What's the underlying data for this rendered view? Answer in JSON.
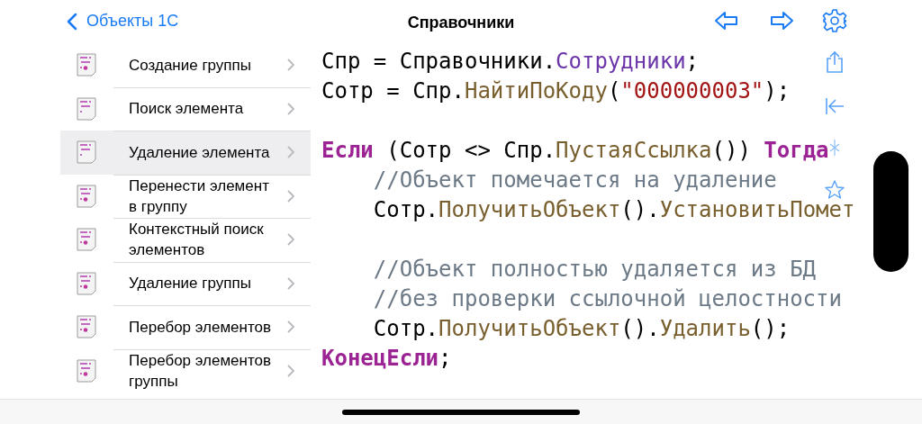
{
  "nav": {
    "back": "Объекты 1С",
    "title": "Справочники"
  },
  "list": [
    {
      "label": "Создание группы",
      "selected": false,
      "dot": true
    },
    {
      "label": "Поиск элемента",
      "selected": false,
      "dot": false
    },
    {
      "label": "Удаление элемента",
      "selected": true,
      "dot": false
    },
    {
      "label": "Перенести элемент в группу",
      "selected": false,
      "dot": true
    },
    {
      "label": "Контекстный поиск элементов",
      "selected": false,
      "dot": true
    },
    {
      "label": "Удаление группы",
      "selected": false,
      "dot": true
    },
    {
      "label": "Перебор элементов",
      "selected": false,
      "dot": true
    },
    {
      "label": "Перебор элементов группы",
      "selected": false,
      "dot": true
    }
  ],
  "code": [
    {
      "kind": "code",
      "tokens": [
        {
          "t": "Спр = Справочники.",
          "kind": "plain"
        },
        {
          "t": "Сотрудники",
          "kind": "type"
        },
        {
          "t": ";",
          "kind": "plain"
        }
      ]
    },
    {
      "kind": "code",
      "tokens": [
        {
          "t": "Сотр = Спр.",
          "kind": "plain"
        },
        {
          "t": "НайтиПоКоду",
          "kind": "method"
        },
        {
          "t": "(",
          "kind": "plain"
        },
        {
          "t": "\"000000003\"",
          "kind": "string"
        },
        {
          "t": ");",
          "kind": "plain"
        }
      ]
    },
    {
      "kind": "blank"
    },
    {
      "kind": "code",
      "tokens": [
        {
          "t": "Если",
          "kind": "keyword"
        },
        {
          "t": " (Сотр <> Спр.",
          "kind": "plain"
        },
        {
          "t": "ПустаяСсылка",
          "kind": "method"
        },
        {
          "t": "()) ",
          "kind": "plain"
        },
        {
          "t": "Тогда",
          "kind": "keyword"
        }
      ]
    },
    {
      "kind": "code",
      "tokens": [
        {
          "t": "    //Объект помечается на удаление",
          "kind": "comment"
        }
      ]
    },
    {
      "kind": "code",
      "tokens": [
        {
          "t": "    Сотр.",
          "kind": "plain"
        },
        {
          "t": "ПолучитьОбъект",
          "kind": "method"
        },
        {
          "t": "().",
          "kind": "plain"
        },
        {
          "t": "УстановитьПомет",
          "kind": "method"
        }
      ]
    },
    {
      "kind": "blank"
    },
    {
      "kind": "code",
      "tokens": [
        {
          "t": "    //Объект полностью удаляется из БД",
          "kind": "comment"
        }
      ]
    },
    {
      "kind": "code",
      "tokens": [
        {
          "t": "    //без проверки ссылочной целостности",
          "kind": "comment"
        }
      ]
    },
    {
      "kind": "code",
      "tokens": [
        {
          "t": "    Сотр.",
          "kind": "plain"
        },
        {
          "t": "ПолучитьОбъект",
          "kind": "method"
        },
        {
          "t": "().",
          "kind": "plain"
        },
        {
          "t": "Удалить",
          "kind": "method"
        },
        {
          "t": "();",
          "kind": "plain"
        }
      ]
    },
    {
      "kind": "code",
      "tokens": [
        {
          "t": "КонецЕсли",
          "kind": "keyword"
        },
        {
          "t": ";",
          "kind": "plain"
        }
      ]
    }
  ]
}
